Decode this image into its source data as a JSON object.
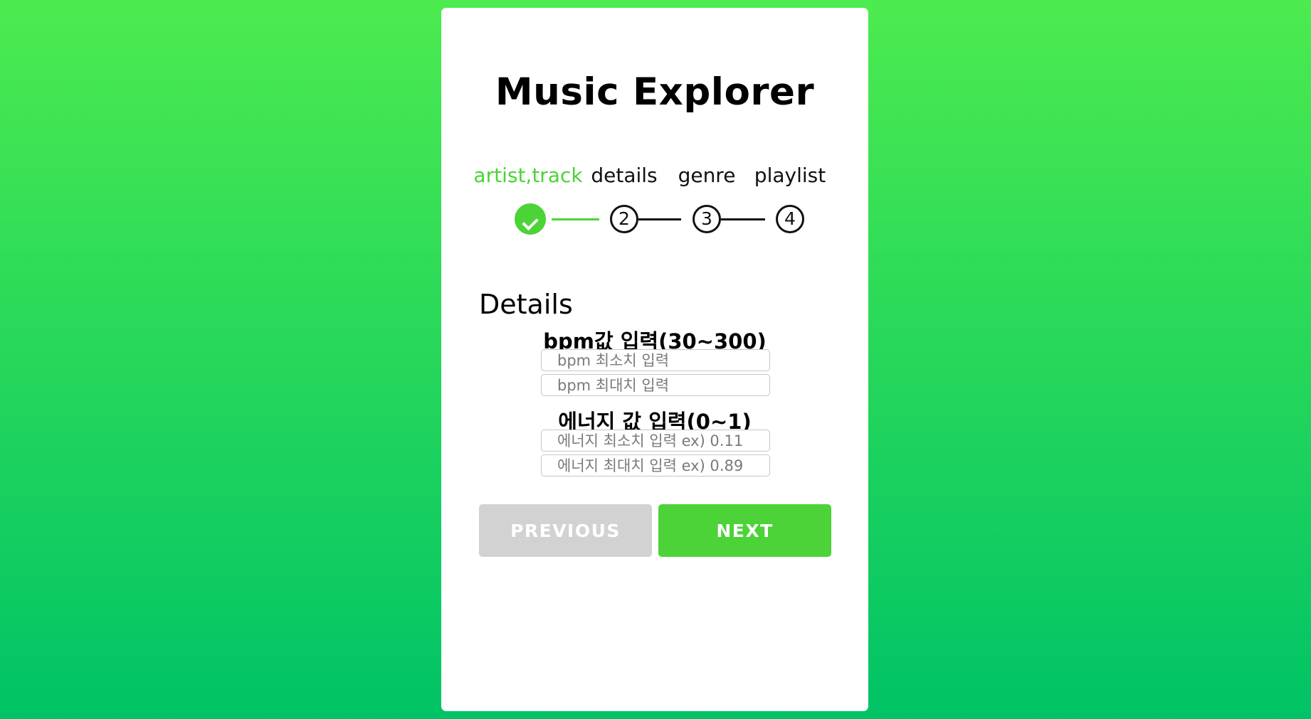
{
  "app": {
    "title": "Music Explorer"
  },
  "steps": [
    {
      "label": "artist,track",
      "number": "",
      "status": "completed"
    },
    {
      "label": "details",
      "number": "2",
      "status": "current"
    },
    {
      "label": "genre",
      "number": "3",
      "status": "pending"
    },
    {
      "label": "playlist",
      "number": "4",
      "status": "pending"
    }
  ],
  "form": {
    "section_title": "Details",
    "bpm": {
      "label": "bpm값 입력(30~300)",
      "min_placeholder": "bpm 최소치 입력",
      "max_placeholder": "bpm 최대치 입력",
      "min_value": "",
      "max_value": ""
    },
    "energy": {
      "label": "에너지 값 입력(0~1)",
      "min_placeholder": "에너지 최소치 입력 ex) 0.11",
      "max_placeholder": "에너지 최대치 입력 ex) 0.89",
      "min_value": "",
      "max_value": ""
    }
  },
  "buttons": {
    "previous": "PREVIOUS",
    "next": "NEXT"
  },
  "colors": {
    "accent": "#4cd337",
    "background_top": "#4ceb4f",
    "background_bottom": "#00c366",
    "disabled": "#d2d2d2"
  },
  "icons": {
    "completed_step": "check-icon"
  }
}
